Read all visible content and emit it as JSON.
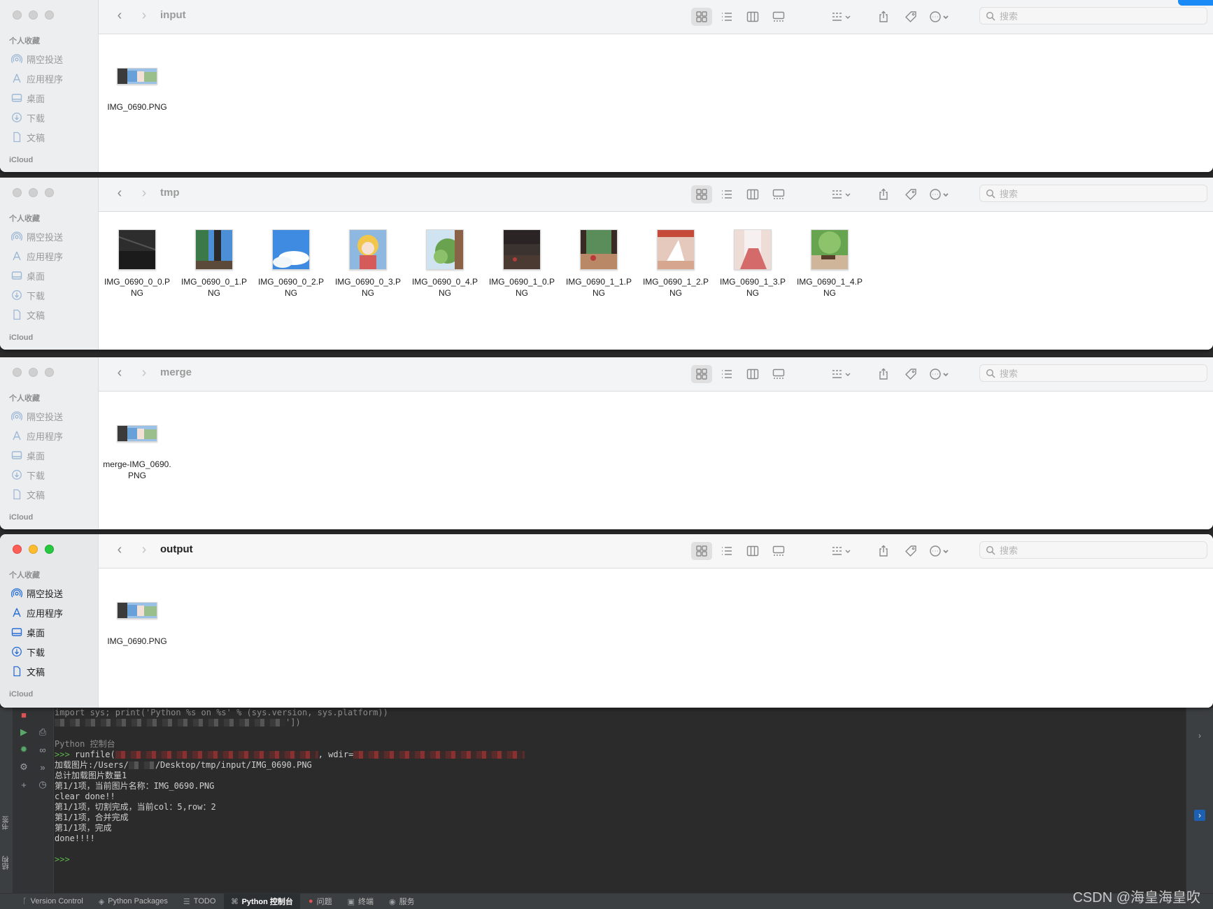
{
  "sidebar": {
    "section_favorites": "个人收藏",
    "section_icloud": "iCloud",
    "items": [
      {
        "label": "隔空投送",
        "icon": "airdrop-icon"
      },
      {
        "label": "应用程序",
        "icon": "applications-icon"
      },
      {
        "label": "桌面",
        "icon": "desktop-icon"
      },
      {
        "label": "下载",
        "icon": "downloads-icon"
      },
      {
        "label": "文稿",
        "icon": "documents-icon"
      }
    ]
  },
  "search_placeholder": "搜索",
  "windows": [
    {
      "title": "input",
      "files": [
        {
          "name": "IMG_0690.PNG"
        }
      ]
    },
    {
      "title": "tmp",
      "files": [
        {
          "name": "IMG_0690_0_0.PNG"
        },
        {
          "name": "IMG_0690_0_1.PNG"
        },
        {
          "name": "IMG_0690_0_2.PNG"
        },
        {
          "name": "IMG_0690_0_3.PNG"
        },
        {
          "name": "IMG_0690_0_4.PNG"
        },
        {
          "name": "IMG_0690_1_0.PNG"
        },
        {
          "name": "IMG_0690_1_1.PNG"
        },
        {
          "name": "IMG_0690_1_2.PNG"
        },
        {
          "name": "IMG_0690_1_3.PNG"
        },
        {
          "name": "IMG_0690_1_4.PNG"
        }
      ]
    },
    {
      "title": "merge",
      "files": [
        {
          "name": "merge-IMG_0690.PNG"
        }
      ]
    },
    {
      "title": "output",
      "files": [
        {
          "name": "IMG_0690.PNG"
        }
      ]
    }
  ],
  "console": {
    "line_import": "import sys; print('Python %s on %s' % (sys.version, sys.platform))",
    "line_extend": "'])",
    "section_title": "Python 控制台",
    "prompt": ">>>",
    "runfile_cmd": "runfile(",
    "runfile_wdir": ", wdir=",
    "output": [
      "加载图片:/Users/",
      "/Desktop/tmp/input/IMG_0690.PNG",
      "总计加载图片数量1",
      "第1/1项，当前图片名称：IMG_0690.PNG",
      "clear done!!",
      "第1/1项，切割完成，当前col：5,row：2",
      "第1/1项，合并完成",
      "第1/1项，完成",
      "done!!!!"
    ]
  },
  "left_tool_labels": [
    "书签",
    "结构"
  ],
  "statusbar": [
    {
      "label": "Version Control",
      "icon": "branch-icon"
    },
    {
      "label": "Python Packages",
      "icon": "packages-icon"
    },
    {
      "label": "TODO",
      "icon": "todo-icon"
    },
    {
      "label": "Python 控制台",
      "icon": "python-console-icon",
      "active": true
    },
    {
      "label": "问题",
      "icon": "problems-icon"
    },
    {
      "label": "终端",
      "icon": "terminal-icon"
    },
    {
      "label": "服务",
      "icon": "services-icon"
    }
  ],
  "watermark": "CSDN @海皇海皇吹"
}
